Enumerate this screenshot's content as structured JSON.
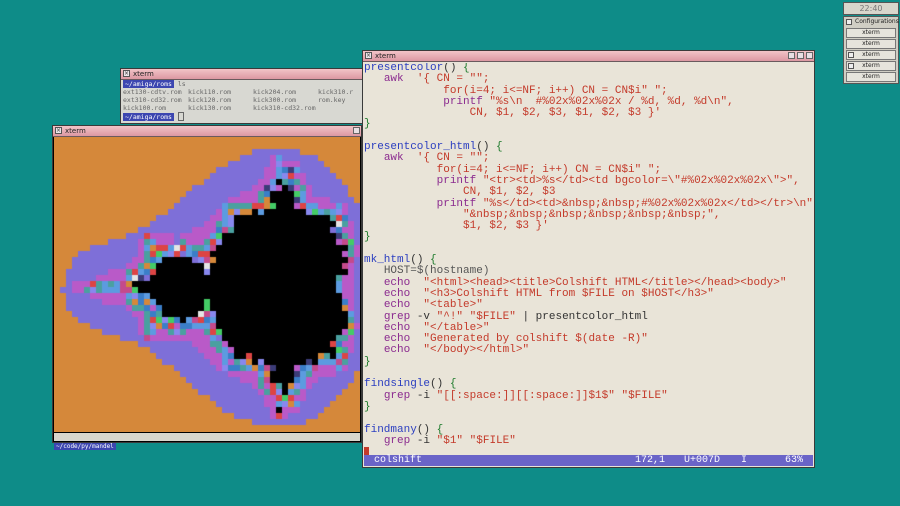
{
  "clock": "22:40",
  "panel": {
    "title": "Configurations 6",
    "items": [
      "xterm",
      "xterm",
      "xterm",
      "xterm",
      "xterm"
    ]
  },
  "xterm_ls": {
    "title": "xterm",
    "prompt": "~/amiga/roms",
    "command": "ls",
    "rows": [
      [
        "ext130-cdtv.rom",
        "kick110.rom",
        "kick204.rom",
        "kick310.r"
      ],
      [
        "ext310-cd32.rom",
        "kick120.rom",
        "kick300.rom",
        "rom.key"
      ],
      [
        "kick100.rom",
        "kick130.rom",
        "kick310-cd32.rom",
        ""
      ]
    ]
  },
  "xterm_mandel": {
    "title": "xterm",
    "status_path": "~/code/py/mandel"
  },
  "editor": {
    "title": "xterm",
    "status": {
      "filename": "colshift",
      "position": "172,1",
      "char": "U+007D",
      "mode": "I",
      "percent": "63%"
    }
  },
  "colors": {
    "desktop": "#0e8c88",
    "titlebar": "#dc98a2",
    "statusbar": "#6a64c8",
    "prompt": "#3c46b0"
  }
}
